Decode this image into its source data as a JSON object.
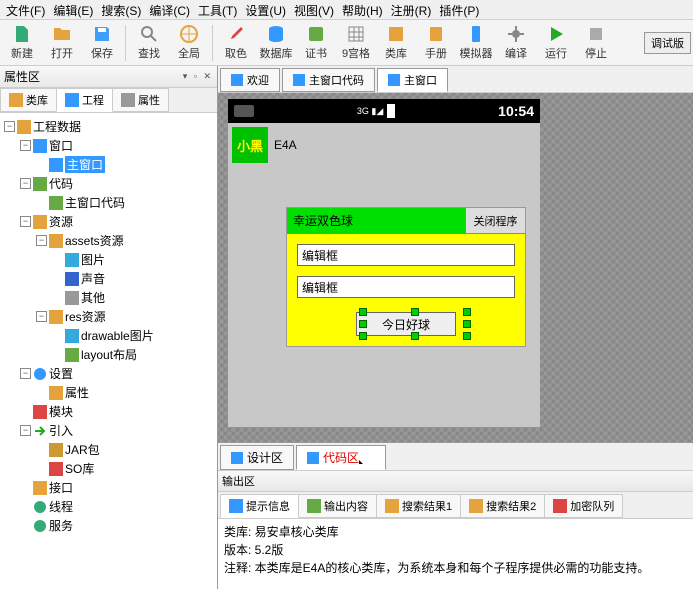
{
  "menu": [
    "文件(F)",
    "编辑(E)",
    "搜索(S)",
    "编译(C)",
    "工具(T)",
    "设置(U)",
    "视图(V)",
    "帮助(H)",
    "注册(R)",
    "插件(P)"
  ],
  "toolbar": [
    {
      "label": "新建",
      "icon": "file",
      "color": "#3a7"
    },
    {
      "label": "打开",
      "icon": "folder",
      "color": "#e6a23c"
    },
    {
      "label": "保存",
      "icon": "save",
      "color": "#409eff"
    },
    {
      "sep": true
    },
    {
      "label": "查找",
      "icon": "search",
      "color": "#888"
    },
    {
      "label": "全局",
      "icon": "globe",
      "color": "#e6a23c"
    },
    {
      "sep": true
    },
    {
      "label": "取色",
      "icon": "dropper",
      "color": "#d44"
    },
    {
      "label": "数据库",
      "icon": "db",
      "color": "#39f"
    },
    {
      "label": "证书",
      "icon": "cert",
      "color": "#6a4"
    },
    {
      "label": "9宫格",
      "icon": "grid",
      "color": "#888"
    },
    {
      "label": "类库",
      "icon": "lib",
      "color": "#e6a23c"
    },
    {
      "label": "手册",
      "icon": "book",
      "color": "#e6a23c"
    },
    {
      "label": "模拟器",
      "icon": "phone",
      "color": "#39f"
    },
    {
      "label": "编译",
      "icon": "gear",
      "color": "#888"
    },
    {
      "label": "运行",
      "icon": "play",
      "color": "#2a2"
    },
    {
      "label": "停止",
      "icon": "stop",
      "color": "#aaa"
    }
  ],
  "debug_tag": "调试版",
  "left_panel": {
    "title": "属性区",
    "tabs": [
      "类库",
      "工程",
      "属性"
    ],
    "active": 1
  },
  "tree": {
    "root": "工程数据",
    "window": "窗口",
    "main_window": "主窗口",
    "code": "代码",
    "main_code": "主窗口代码",
    "res": "资源",
    "assets": "assets资源",
    "pic": "图片",
    "sound": "声音",
    "other": "其他",
    "res2": "res资源",
    "drawable": "drawable图片",
    "layout": "layout布局",
    "settings": "设置",
    "props": "属性",
    "module": "模块",
    "import": "引入",
    "jar": "JAR包",
    "so": "SO库",
    "iface": "接口",
    "thread": "线程",
    "service": "服务"
  },
  "doc_tabs": [
    "欢迎",
    "主窗口代码",
    "主窗口"
  ],
  "doc_active": 2,
  "phone": {
    "clock": "10:54",
    "app_icon_text": "小黑",
    "app_title": "E4A",
    "panel_title": "幸运双色球",
    "close_btn": "关闭程序",
    "field1": "编辑框",
    "field2": "编辑框",
    "action_btn": "今日好球"
  },
  "design_tabs": [
    "设计区",
    "代码区"
  ],
  "design_active": 1,
  "output": {
    "title": "输出区",
    "tabs": [
      "提示信息",
      "输出内容",
      "搜索结果1",
      "搜索结果2",
      "加密队列"
    ],
    "line1": "类库:  易安卓核心类库",
    "line2": "版本:  5.2版",
    "line3": "注释:  本类库是E4A的核心类库，为系统本身和每个子程序提供必需的功能支持。"
  }
}
